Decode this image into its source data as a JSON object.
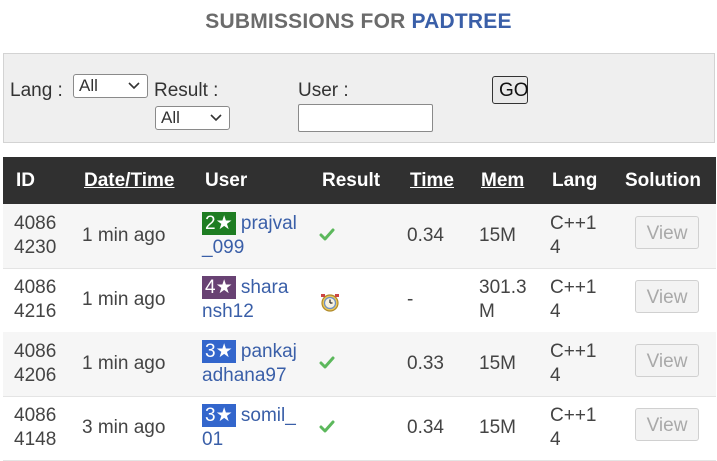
{
  "title": {
    "prefix": "SUBMISSIONS FOR ",
    "problem": "PADTREE"
  },
  "filters": {
    "lang_label": "Lang :",
    "lang_value": "All",
    "result_label": "Result :",
    "result_value": "All",
    "user_label": "User :",
    "user_value": "",
    "go_label": "GO"
  },
  "columns": {
    "id": "ID",
    "datetime": "Date/Time",
    "user": "User",
    "result": "Result",
    "time": "Time",
    "mem": "Mem",
    "lang": "Lang",
    "solution": "Solution"
  },
  "rows": [
    {
      "id_a": "4086",
      "id_b": "4230",
      "when": "1 min ago",
      "stars": "2★",
      "star_color": "#1e7d22",
      "user_a": "prajval",
      "user_b": "_099",
      "result_icon": "check-icon",
      "time": "0.34",
      "mem_a": "15M",
      "mem_b": "",
      "lang_a": "C++1",
      "lang_b": "4",
      "view": "View"
    },
    {
      "id_a": "4086",
      "id_b": "4216",
      "when": "1 min ago",
      "stars": "4★",
      "star_color": "#684273",
      "user_a": "shara",
      "user_b": "nsh12",
      "result_icon": "running-clock-icon",
      "time": "-",
      "mem_a": "301.3",
      "mem_b": "M",
      "lang_a": "C++1",
      "lang_b": "4",
      "view": "View"
    },
    {
      "id_a": "4086",
      "id_b": "4206",
      "when": "1 min ago",
      "stars": "3★",
      "star_color": "#3366cc",
      "user_a": "pankaj",
      "user_b": "adhana97",
      "result_icon": "check-icon",
      "time": "0.33",
      "mem_a": "15M",
      "mem_b": "",
      "lang_a": "C++1",
      "lang_b": "4",
      "view": "View"
    },
    {
      "id_a": "4086",
      "id_b": "4148",
      "when": "3 min ago",
      "stars": "3★",
      "star_color": "#3366cc",
      "user_a": "somil_",
      "user_b": "01",
      "result_icon": "check-icon",
      "time": "0.34",
      "mem_a": "15M",
      "mem_b": "",
      "lang_a": "C++1",
      "lang_b": "4",
      "view": "View"
    }
  ],
  "colors": {
    "header_bg": "#303030",
    "link": "#3a5fa8",
    "check": "#5cb85c"
  }
}
